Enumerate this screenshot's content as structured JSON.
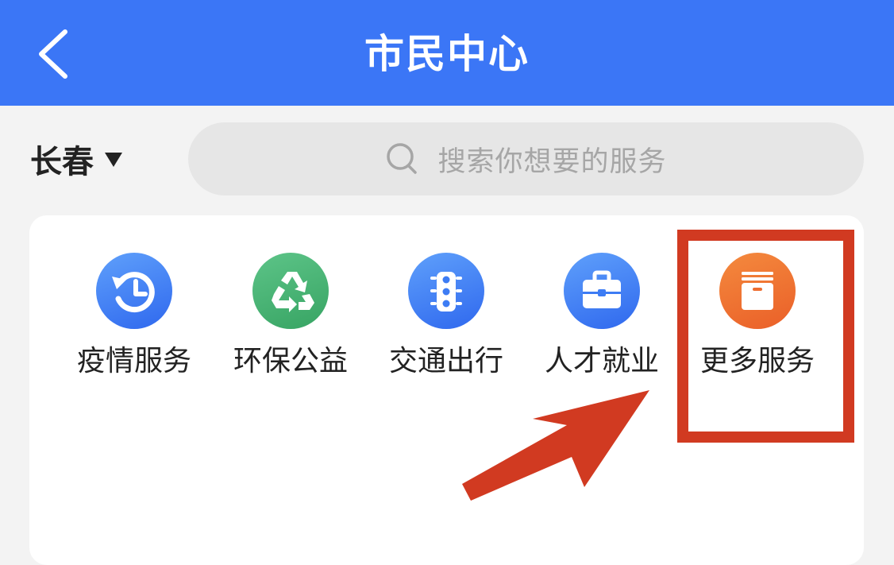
{
  "header": {
    "title": "市民中心",
    "back_icon": "chevron-left-icon",
    "background_color": "#3b76f6"
  },
  "location": {
    "city": "长春",
    "caret_icon": "caret-down-icon"
  },
  "search": {
    "placeholder": "搜索你想要的服务",
    "icon": "search-icon"
  },
  "services": [
    {
      "label": "疫情服务",
      "icon": "history-clock-icon",
      "color": "#3d7cf4"
    },
    {
      "label": "环保公益",
      "icon": "recycle-icon",
      "color": "#45b070"
    },
    {
      "label": "交通出行",
      "icon": "traffic-light-icon",
      "color": "#3d7cf4"
    },
    {
      "label": "人才就业",
      "icon": "briefcase-icon",
      "color": "#3d7cf4"
    },
    {
      "label": "更多服务",
      "icon": "archive-box-icon",
      "color": "#ee6d30"
    }
  ],
  "annotation": {
    "highlight_color": "#d13a21",
    "arrow_icon": "pointer-arrow-icon"
  }
}
